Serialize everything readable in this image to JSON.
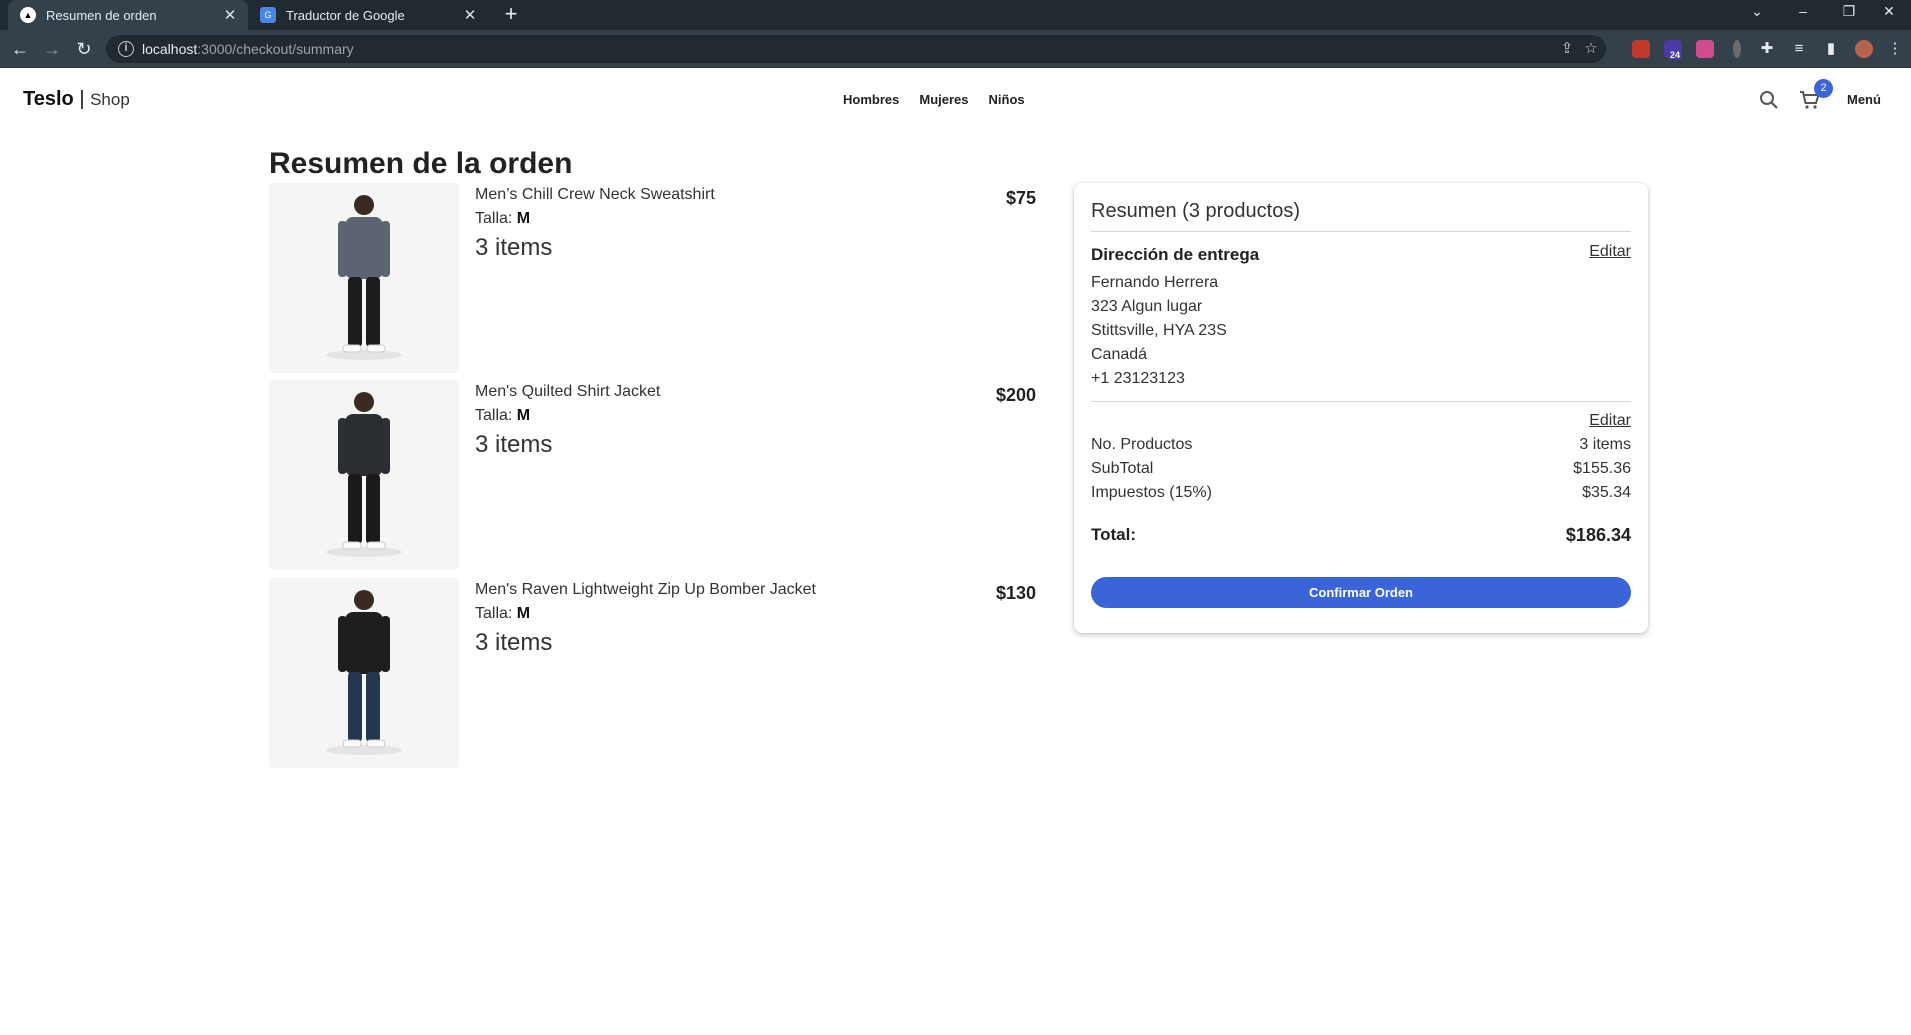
{
  "browser": {
    "tabs": [
      {
        "title": "Resumen de orden",
        "close": "✕"
      },
      {
        "title": "Traductor de Google",
        "close": "✕"
      }
    ],
    "new_tab": "+",
    "url_host": "localhost",
    "url_rest": ":3000/checkout/summary",
    "extension_badge": "24"
  },
  "navbar": {
    "brand": "Teslo",
    "brand_separator": " | ",
    "brand_sub": "Shop",
    "links": [
      "Hombres",
      "Mujeres",
      "Niños"
    ],
    "cart_count": "2",
    "menu_label": "Menú"
  },
  "page": {
    "title": "Resumen de la orden"
  },
  "products": [
    {
      "name": "Men’s Chill Crew Neck Sweatshirt",
      "size_label": "Talla: ",
      "size": "M",
      "quantity": "3 items",
      "price": "$75",
      "shirt_color": "#5b6470",
      "pants_color": "#1c1c1c"
    },
    {
      "name": "Men's Quilted Shirt Jacket",
      "size_label": "Talla: ",
      "size": "M",
      "quantity": "3 items",
      "price": "$200",
      "shirt_color": "#2b2e33",
      "pants_color": "#1a1a1a"
    },
    {
      "name": "Men's Raven Lightweight Zip Up Bomber Jacket",
      "size_label": "Talla: ",
      "size": "M",
      "quantity": "3 items",
      "price": "$130",
      "shirt_color": "#1e1e1e",
      "pants_color": "#243650"
    }
  ],
  "summary": {
    "title": "Resumen (3 productos)",
    "address_title": "Dirección de entrega",
    "edit_label": "Editar",
    "address_lines": [
      "Fernando Herrera",
      "323 Algun lugar",
      "Stittsville, HYA 23S",
      "Canadá",
      "+1 23123123"
    ],
    "rows": [
      {
        "label": "No. Productos",
        "value": "3 items"
      },
      {
        "label": "SubTotal",
        "value": "$155.36"
      },
      {
        "label": "Impuestos (15%)",
        "value": "$35.34"
      }
    ],
    "total_label": "Total:",
    "total_value": "$186.34",
    "confirm_label": "Confirmar Orden"
  },
  "colors": {
    "accent": "#3a64d8",
    "chrome_dark": "#202a30",
    "chrome_toolbar": "#34414a"
  }
}
